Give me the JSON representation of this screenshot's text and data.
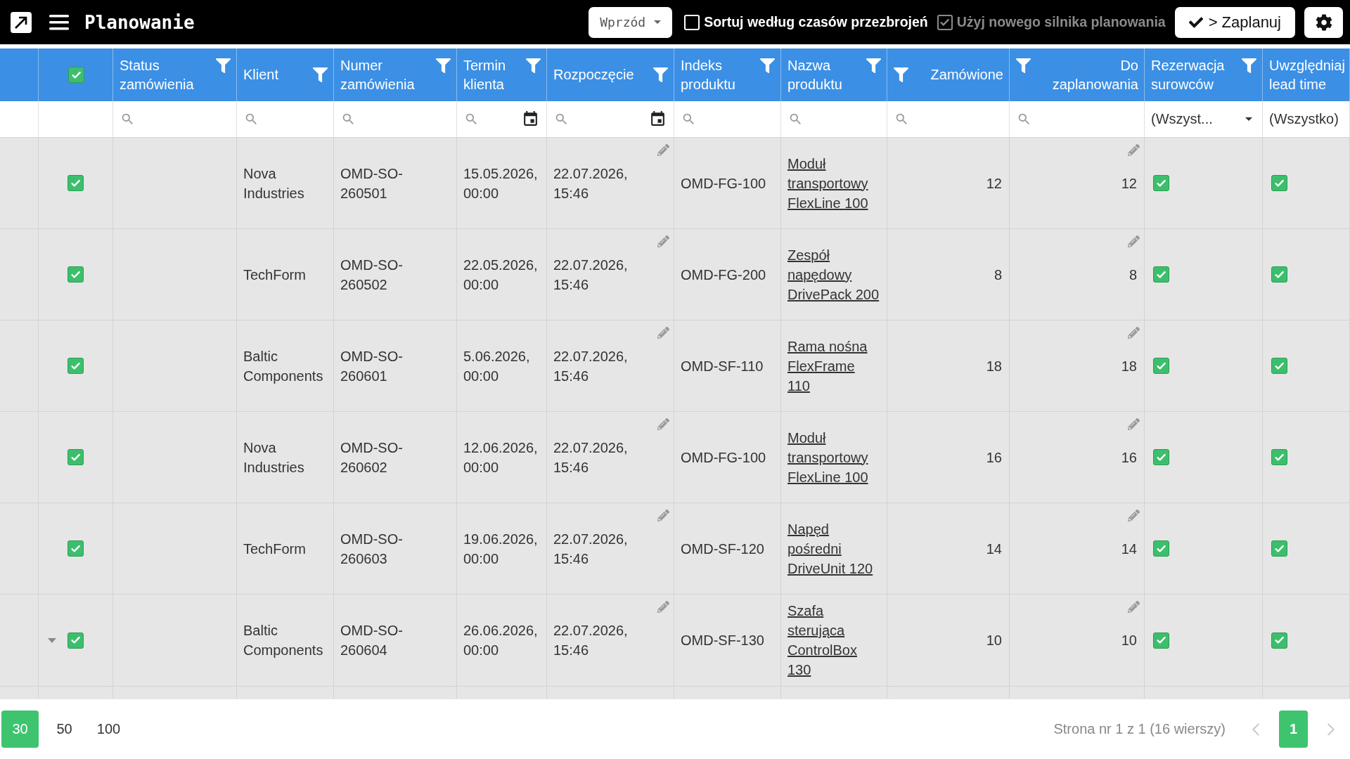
{
  "app_bar": {
    "title": "Planowanie"
  },
  "toolbar": {
    "direction_dropdown": {
      "value": "Wprzód"
    },
    "options": [
      {
        "label": "Sortuj według czasów przezbrojeń",
        "checked": false,
        "disabled": false
      },
      {
        "label": "Użyj nowego silnika planowania",
        "checked": true,
        "disabled": true
      }
    ],
    "schedule_button": {
      "label": "> Zaplanuj"
    }
  },
  "table": {
    "select_all": {
      "checked": true
    },
    "columns": [
      {
        "label": "Status zamówienia",
        "kind": "text",
        "filter": {
          "kind": "search"
        },
        "filter_button": true,
        "editable": false
      },
      {
        "label": "Klient",
        "kind": "text",
        "filter": {
          "kind": "search"
        },
        "filter_button": true,
        "editable": false
      },
      {
        "label": "Numer zamówienia",
        "kind": "text",
        "filter": {
          "kind": "search"
        },
        "filter_button": true,
        "editable": false
      },
      {
        "label": "Termin klienta",
        "kind": "date",
        "filter": {
          "kind": "date"
        },
        "filter_button": true,
        "editable": false
      },
      {
        "label": "Rozpoczęcie",
        "kind": "date",
        "filter": {
          "kind": "date"
        },
        "filter_button": true,
        "editable": true
      },
      {
        "label": "Indeks produktu",
        "kind": "text",
        "filter": {
          "kind": "search"
        },
        "filter_button": true,
        "editable": false
      },
      {
        "label": "Nazwa produktu",
        "kind": "link",
        "filter": {
          "kind": "search"
        },
        "filter_button": true,
        "editable": false
      },
      {
        "label": "Zamówione",
        "kind": "number",
        "filter": {
          "kind": "search"
        },
        "filter_button": true,
        "editable": false
      },
      {
        "label": "Do zaplanowania",
        "kind": "number",
        "filter": {
          "kind": "search"
        },
        "filter_button": true,
        "editable": true
      },
      {
        "label": "Rezerwacja surowców",
        "kind": "check",
        "filter": {
          "kind": "dropdown",
          "value": "(Wszyst..."
        },
        "filter_button": true,
        "editable": false
      },
      {
        "label": "Uwzględniaj lead time",
        "kind": "check",
        "filter": {
          "kind": "value",
          "value": "(Wszystko)"
        },
        "filter_button": false,
        "editable": false
      }
    ],
    "rows": [
      {
        "hovered": false,
        "checked": true,
        "cells": [
          null,
          "Nova Industries",
          "OMD-SO-260501",
          "15.05.2026, 00:00",
          "22.07.2026, 15:46",
          "OMD-FG-100",
          "Moduł transportowy FlexLine 100",
          "12",
          "12",
          {
            "checked": true
          },
          {
            "checked": true
          }
        ]
      },
      {
        "hovered": false,
        "checked": true,
        "cells": [
          null,
          "TechForm",
          "OMD-SO-260502",
          "22.05.2026, 00:00",
          "22.07.2026, 15:46",
          "OMD-FG-200",
          "Zespół napędowy DrivePack 200",
          "8",
          "8",
          {
            "checked": true
          },
          {
            "checked": true
          }
        ]
      },
      {
        "hovered": false,
        "checked": true,
        "cells": [
          null,
          "Baltic Components",
          "OMD-SO-260601",
          "5.06.2026, 00:00",
          "22.07.2026, 15:46",
          "OMD-SF-110",
          "Rama nośna FlexFrame 110",
          "18",
          "18",
          {
            "checked": true
          },
          {
            "checked": true
          }
        ]
      },
      {
        "hovered": false,
        "checked": true,
        "cells": [
          null,
          "Nova Industries",
          "OMD-SO-260602",
          "12.06.2026, 00:00",
          "22.07.2026, 15:46",
          "OMD-FG-100",
          "Moduł transportowy FlexLine 100",
          "16",
          "16",
          {
            "checked": true
          },
          {
            "checked": true
          }
        ]
      },
      {
        "hovered": false,
        "checked": true,
        "cells": [
          null,
          "TechForm",
          "OMD-SO-260603",
          "19.06.2026, 00:00",
          "22.07.2026, 15:46",
          "OMD-SF-120",
          "Napęd pośredni DriveUnit 120",
          "14",
          "14",
          {
            "checked": true
          },
          {
            "checked": true
          }
        ]
      },
      {
        "hovered": true,
        "checked": true,
        "cells": [
          null,
          "Baltic Components",
          "OMD-SO-260604",
          "26.06.2026, 00:00",
          "22.07.2026, 15:46",
          "OMD-SF-130",
          "Szafa sterująca ControlBox 130",
          "10",
          "10",
          {
            "checked": true
          },
          {
            "checked": true
          }
        ]
      }
    ]
  },
  "footer": {
    "page_sizes": [
      {
        "label": "30",
        "selected": true
      },
      {
        "label": "50",
        "selected": false
      },
      {
        "label": "100",
        "selected": false
      }
    ],
    "page_info": "Strona nr 1 z 1 (16 wierszy)",
    "previous": {
      "disabled": true
    },
    "pages": [
      {
        "label": "1",
        "selected": true
      }
    ],
    "next": {
      "disabled": true
    }
  }
}
